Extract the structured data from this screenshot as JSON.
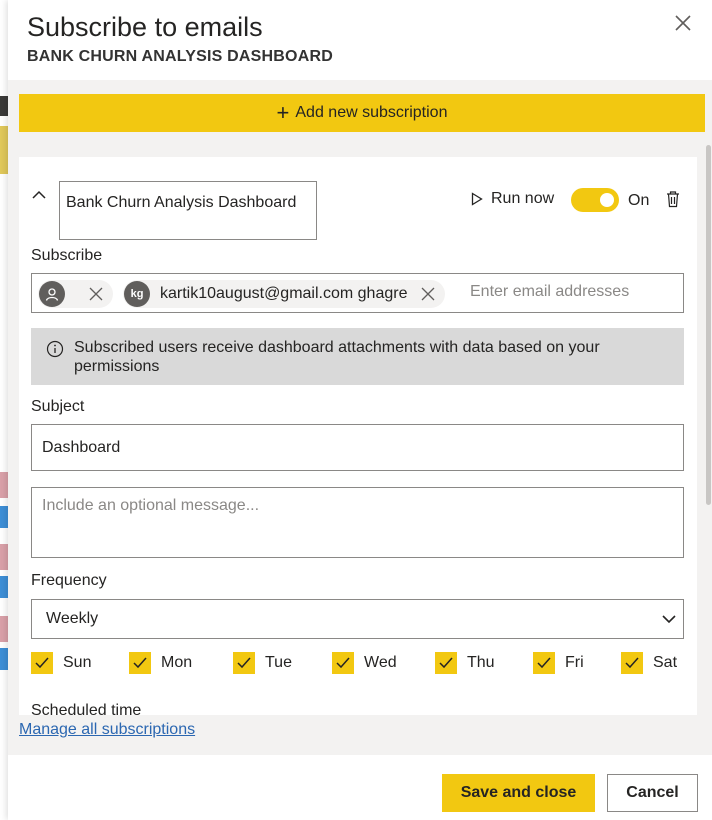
{
  "dialog": {
    "title": "Subscribe to emails",
    "subtitle": "BANK CHURN ANALYSIS DASHBOARD",
    "close_icon": "close-icon"
  },
  "add_subscription": {
    "label": "Add new subscription",
    "icon": "plus-icon"
  },
  "subscription": {
    "name": "Bank Churn Analysis Dashboard",
    "run_now_label": "Run now",
    "toggle_state": "on",
    "toggle_label": "On",
    "subscribe_label": "Subscribe",
    "recipients": [
      {
        "avatar_initials": "",
        "text": ""
      },
      {
        "avatar_initials": "kg",
        "text": "kartik10august@gmail.com ghagre"
      }
    ],
    "email_placeholder": "Enter email addresses",
    "info_text": "Subscribed users receive dashboard attachments with data based on your permissions",
    "subject_label": "Subject",
    "subject_value": "Dashboard",
    "message_placeholder": "Include an optional message...",
    "frequency_label": "Frequency",
    "frequency_value": "Weekly",
    "days": [
      {
        "label": "Sun",
        "checked": true
      },
      {
        "label": "Mon",
        "checked": true
      },
      {
        "label": "Tue",
        "checked": true
      },
      {
        "label": "Wed",
        "checked": true
      },
      {
        "label": "Thu",
        "checked": true
      },
      {
        "label": "Fri",
        "checked": true
      },
      {
        "label": "Sat",
        "checked": true
      }
    ],
    "scheduled_time_label": "Scheduled time"
  },
  "footer": {
    "manage_link": "Manage all subscriptions",
    "save_label": "Save and close",
    "cancel_label": "Cancel"
  },
  "colors": {
    "accent": "#f2c811",
    "link": "#2b67b1",
    "panel_gray": "#f3f2f1"
  }
}
